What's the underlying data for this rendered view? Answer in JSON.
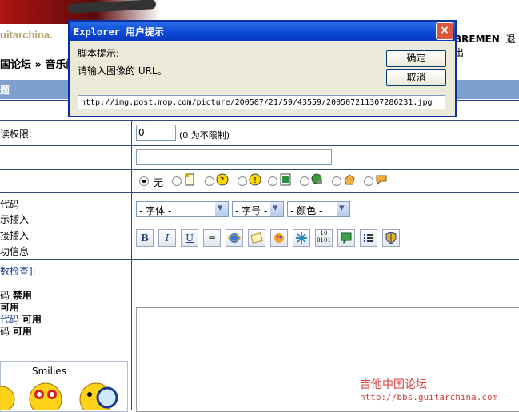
{
  "header": {
    "logo_text": "uitarchina.",
    "user_name": "BREMEN",
    "logout_label": "退出"
  },
  "breadcrumb": "国论坛 » 音乐闲",
  "section_title": "题",
  "form": {
    "permission_label": "读权限:",
    "permission_value": "0",
    "permission_hint": "(0 为不限制)",
    "icon_none_label": "无",
    "code_labels": [
      "代码",
      "示插入",
      "接插入",
      "功信息"
    ],
    "check_link": "数检查]:",
    "status_lines": [
      {
        "prefix": "码",
        "value": "禁用"
      },
      {
        "prefix": "",
        "value": "可用"
      },
      {
        "prefix": "代码",
        "value": "可用"
      },
      {
        "prefix": "码",
        "value": "可用"
      }
    ],
    "font_select": "- 字体 -",
    "size_select": "- 字号 -",
    "color_select": "- 颜色 -",
    "toolbar": {
      "bold": "B",
      "italic": "I",
      "underline": "U"
    }
  },
  "smilies_title": "Smilies",
  "watermark": {
    "cn": "吉他中国论坛",
    "url": "http://bbs.guitarchina.com"
  },
  "dialog": {
    "title": "Explorer 用户提示",
    "label": "脚本提示:",
    "message": "请输入图像的 URL。",
    "ok_label": "确定",
    "cancel_label": "取消",
    "input_value": "http://img.post.mop.com/picture/200507/21/59/43559/200507211307286231.jpg"
  },
  "colors": {
    "section_bg": "#7f9fce",
    "dialog_title_bg": "#0a48d6",
    "watermark": "#d64040"
  }
}
